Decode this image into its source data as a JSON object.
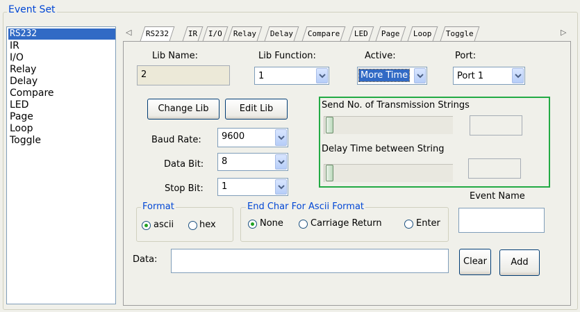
{
  "event_set": {
    "title": "Event Set",
    "list": [
      {
        "label": "RS232",
        "selected": true
      },
      {
        "label": "IR"
      },
      {
        "label": "I/O"
      },
      {
        "label": "Relay"
      },
      {
        "label": "Delay"
      },
      {
        "label": "Compare"
      },
      {
        "label": "LED"
      },
      {
        "label": "Page"
      },
      {
        "label": "Loop"
      },
      {
        "label": "Toggle"
      }
    ]
  },
  "tabs": {
    "left_arrow": "◁",
    "right_arrow": "▷",
    "items": [
      "RS232",
      "IR",
      "I/O",
      "Relay",
      "Delay",
      "Compare",
      "LED",
      "Page",
      "Loop",
      "Toggle"
    ],
    "active_index": 0
  },
  "lib": {
    "lib_name_label": "Lib Name:",
    "lib_name_value": "2",
    "lib_function_label": "Lib Function:",
    "lib_function_value": "1",
    "active_label": "Active:",
    "active_value": "More Time",
    "port_label": "Port:",
    "port_value": "Port 1"
  },
  "buttons": {
    "change_lib": "Change Lib",
    "edit_lib": "Edit Lib",
    "clear": "Clear",
    "add": "Add"
  },
  "serial": {
    "baud_rate_label": "Baud Rate:",
    "baud_rate_value": "9600",
    "data_bit_label": "Data Bit:",
    "data_bit_value": "8",
    "stop_bit_label": "Stop Bit:",
    "stop_bit_value": "1"
  },
  "transmission": {
    "send_label": "Send No. of Transmission Strings",
    "send_value": "",
    "send_slider_level": 0,
    "delay_label": "Delay Time between String",
    "delay_value": "",
    "delay_slider_level": 0,
    "highlight_color": "#22aa44"
  },
  "format": {
    "title": "Format",
    "options": [
      "ascii",
      "hex"
    ],
    "selected": "ascii"
  },
  "end_char": {
    "title": "End Char For Ascii Format",
    "options": [
      "None",
      "Carriage Return",
      "Enter"
    ],
    "selected": "None"
  },
  "event_name": {
    "label": "Event Name",
    "value": ""
  },
  "data": {
    "label": "Data:",
    "value": ""
  },
  "colors": {
    "legend_text": "#0046d5",
    "selection": "#316ac5",
    "focus_box": "#22aa44"
  }
}
